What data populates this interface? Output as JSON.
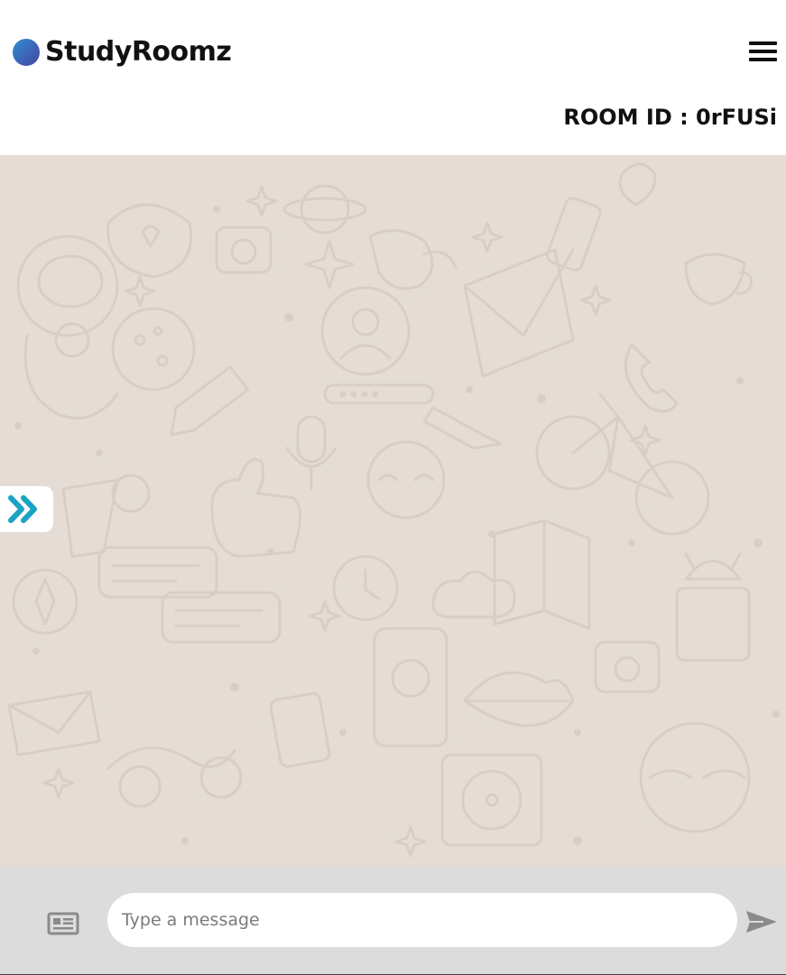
{
  "header": {
    "brand_name": "StudyRoomz",
    "room_id_label": "ROOM ID : 0rFUSi"
  },
  "composer": {
    "message_placeholder": "Type a message"
  },
  "icons": {
    "logo": "circle-logo-icon",
    "menu": "hamburger-menu-icon",
    "sidebar_toggle": "double-chevron-right-icon",
    "attach": "newspaper-icon",
    "send": "send-icon"
  },
  "colors": {
    "chat_background": "#e5ddd5",
    "accent": "#1aa3c4",
    "composer_background": "#dcdcdc",
    "icon_gray": "#8a8a8a"
  }
}
